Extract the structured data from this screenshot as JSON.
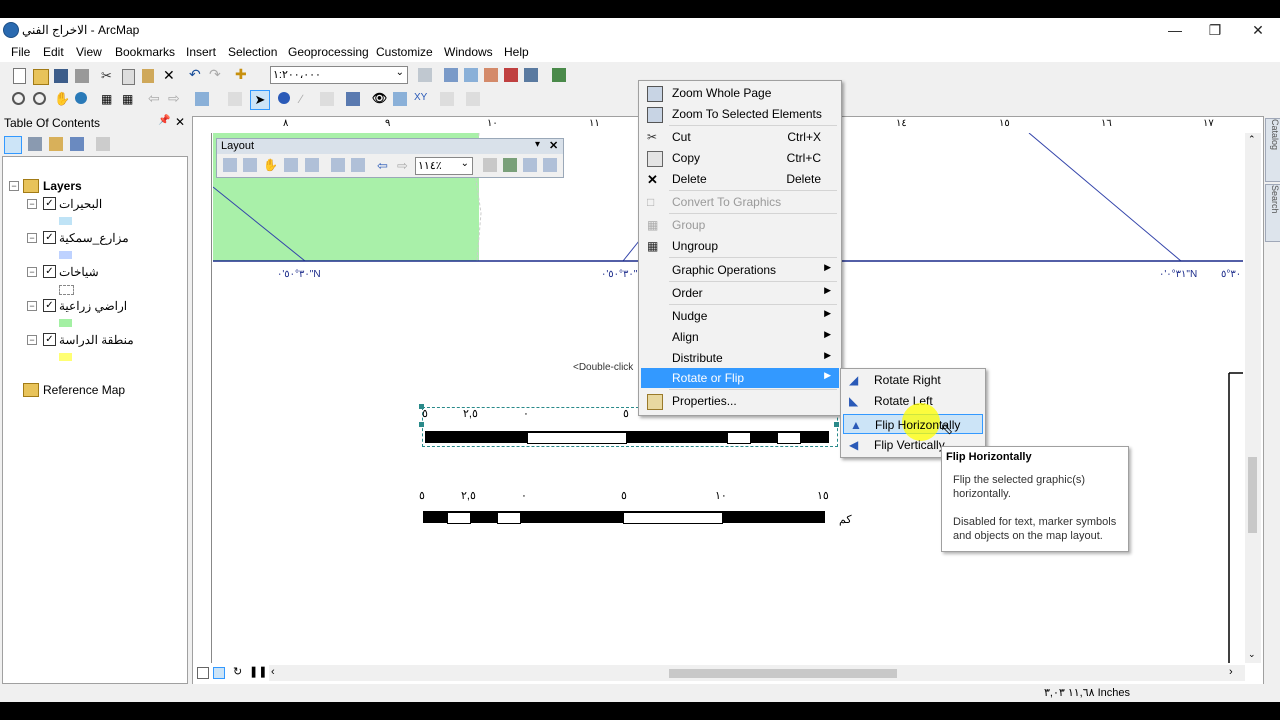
{
  "window": {
    "title": "الاخراج الفني - ArcMap"
  },
  "menubar": [
    "File",
    "Edit",
    "View",
    "Bookmarks",
    "Insert",
    "Selection",
    "Geoprocessing",
    "Customize",
    "Windows",
    "Help"
  ],
  "toolbar": {
    "scale_value": "١:٢٠٠،٠٠٠"
  },
  "toc": {
    "title": "Table Of Contents",
    "pin_glyph": "📌",
    "close_glyph": "✕",
    "root": "Layers",
    "layers": [
      {
        "name": "البحيرات",
        "color": "#bfe3f6"
      },
      {
        "name": "مزارع_سمكية",
        "color": "#bed2ff"
      },
      {
        "name": "شياخات",
        "color": ""
      },
      {
        "name": "اراضي زراعية",
        "color": "#a3f0a3"
      },
      {
        "name": "منطقة الدراسة",
        "color": "#ffff73"
      }
    ],
    "reference": "Reference Map"
  },
  "layout_toolbar": {
    "title": "Layout",
    "zoom": "١١٤٪"
  },
  "ruler": {
    "top": [
      "٨",
      "٩",
      "١٠",
      "١١",
      "١٤",
      "١٥",
      "١٦",
      "١٧"
    ]
  },
  "map": {
    "lat_labels": [
      "٣٠°٥٠'٠\"N",
      "٣٠°٥٠'٠\"",
      "٣١°٠'٠\"N",
      "٣٠°٥"
    ],
    "double_click_hint": "<Double-click",
    "scalebar1_labels": [
      "٥",
      "٢,٥",
      "٠",
      "٥"
    ],
    "scalebar2_labels": [
      "٥",
      "٢,٥",
      "٠",
      "٥",
      "١٠",
      "١٥"
    ],
    "scalebar2_unit": "كم"
  },
  "context_menu": {
    "items": [
      {
        "label": "Zoom Whole Page",
        "shortcut": "",
        "submenu": false,
        "disabled": false
      },
      {
        "label": "Zoom To Selected Elements",
        "shortcut": "",
        "submenu": false,
        "disabled": false
      },
      {
        "label": "Cut",
        "shortcut": "Ctrl+X",
        "submenu": false,
        "disabled": false
      },
      {
        "label": "Copy",
        "shortcut": "Ctrl+C",
        "submenu": false,
        "disabled": false
      },
      {
        "label": "Delete",
        "shortcut": "Delete",
        "submenu": false,
        "disabled": false
      },
      {
        "label": "Convert To Graphics",
        "shortcut": "",
        "submenu": false,
        "disabled": true
      },
      {
        "label": "Group",
        "shortcut": "",
        "submenu": false,
        "disabled": true
      },
      {
        "label": "Ungroup",
        "shortcut": "",
        "submenu": false,
        "disabled": false
      },
      {
        "label": "Graphic Operations",
        "shortcut": "",
        "submenu": true,
        "disabled": false
      },
      {
        "label": "Order",
        "shortcut": "",
        "submenu": true,
        "disabled": false
      },
      {
        "label": "Nudge",
        "shortcut": "",
        "submenu": true,
        "disabled": false
      },
      {
        "label": "Align",
        "shortcut": "",
        "submenu": true,
        "disabled": false
      },
      {
        "label": "Distribute",
        "shortcut": "",
        "submenu": true,
        "disabled": false
      },
      {
        "label": "Rotate or Flip",
        "shortcut": "",
        "submenu": true,
        "disabled": false
      },
      {
        "label": "Properties...",
        "shortcut": "",
        "submenu": false,
        "disabled": false
      }
    ]
  },
  "submenu": {
    "items": [
      "Rotate Right",
      "Rotate Left",
      "Flip Horizontally",
      "Flip Vertically"
    ]
  },
  "tooltip": {
    "title": "Flip Horizontally",
    "line1": "Flip the selected graphic(s) horizontally.",
    "line2": "Disabled for text, marker symbols and objects on the map layout."
  },
  "status": {
    "coords": "١١,٦٨  ٣,٠٣ Inches"
  },
  "side_tabs": [
    "Catalog",
    "Search"
  ],
  "colors": {
    "highlight": "#cce4f7",
    "selected_item": "#3399ff",
    "cursor_highlight": "#ffff00",
    "agri_fill": "#a9f0a9"
  }
}
